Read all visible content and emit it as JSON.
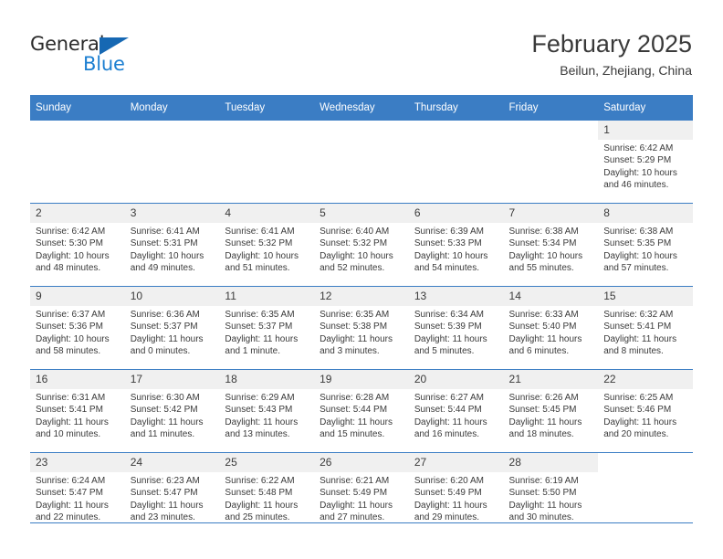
{
  "brand": {
    "name_top": "General",
    "name_bottom": "Blue",
    "triangle_icon": "blue-triangle-logo-mark",
    "color_top": "#2b2b2b",
    "color_bottom": "#1c7fd1",
    "color_triangle": "#1668b3"
  },
  "header": {
    "title": "February 2025",
    "subtitle": "Beilun, Zhejiang, China"
  },
  "theme": {
    "header_blue": "#3b7dc4",
    "daynum_band": "#f0f0f0",
    "text": "#3a3a3a"
  },
  "weekday_headers": [
    "Sunday",
    "Monday",
    "Tuesday",
    "Wednesday",
    "Thursday",
    "Friday",
    "Saturday"
  ],
  "weeks": [
    [
      {
        "day": "",
        "sunrise": "",
        "sunset": "",
        "daylight_line1": "",
        "daylight_line2": ""
      },
      {
        "day": "",
        "sunrise": "",
        "sunset": "",
        "daylight_line1": "",
        "daylight_line2": ""
      },
      {
        "day": "",
        "sunrise": "",
        "sunset": "",
        "daylight_line1": "",
        "daylight_line2": ""
      },
      {
        "day": "",
        "sunrise": "",
        "sunset": "",
        "daylight_line1": "",
        "daylight_line2": ""
      },
      {
        "day": "",
        "sunrise": "",
        "sunset": "",
        "daylight_line1": "",
        "daylight_line2": ""
      },
      {
        "day": "",
        "sunrise": "",
        "sunset": "",
        "daylight_line1": "",
        "daylight_line2": ""
      },
      {
        "day": "1",
        "sunrise": "Sunrise: 6:42 AM",
        "sunset": "Sunset: 5:29 PM",
        "daylight_line1": "Daylight: 10 hours",
        "daylight_line2": "and 46 minutes."
      }
    ],
    [
      {
        "day": "2",
        "sunrise": "Sunrise: 6:42 AM",
        "sunset": "Sunset: 5:30 PM",
        "daylight_line1": "Daylight: 10 hours",
        "daylight_line2": "and 48 minutes."
      },
      {
        "day": "3",
        "sunrise": "Sunrise: 6:41 AM",
        "sunset": "Sunset: 5:31 PM",
        "daylight_line1": "Daylight: 10 hours",
        "daylight_line2": "and 49 minutes."
      },
      {
        "day": "4",
        "sunrise": "Sunrise: 6:41 AM",
        "sunset": "Sunset: 5:32 PM",
        "daylight_line1": "Daylight: 10 hours",
        "daylight_line2": "and 51 minutes."
      },
      {
        "day": "5",
        "sunrise": "Sunrise: 6:40 AM",
        "sunset": "Sunset: 5:32 PM",
        "daylight_line1": "Daylight: 10 hours",
        "daylight_line2": "and 52 minutes."
      },
      {
        "day": "6",
        "sunrise": "Sunrise: 6:39 AM",
        "sunset": "Sunset: 5:33 PM",
        "daylight_line1": "Daylight: 10 hours",
        "daylight_line2": "and 54 minutes."
      },
      {
        "day": "7",
        "sunrise": "Sunrise: 6:38 AM",
        "sunset": "Sunset: 5:34 PM",
        "daylight_line1": "Daylight: 10 hours",
        "daylight_line2": "and 55 minutes."
      },
      {
        "day": "8",
        "sunrise": "Sunrise: 6:38 AM",
        "sunset": "Sunset: 5:35 PM",
        "daylight_line1": "Daylight: 10 hours",
        "daylight_line2": "and 57 minutes."
      }
    ],
    [
      {
        "day": "9",
        "sunrise": "Sunrise: 6:37 AM",
        "sunset": "Sunset: 5:36 PM",
        "daylight_line1": "Daylight: 10 hours",
        "daylight_line2": "and 58 minutes."
      },
      {
        "day": "10",
        "sunrise": "Sunrise: 6:36 AM",
        "sunset": "Sunset: 5:37 PM",
        "daylight_line1": "Daylight: 11 hours",
        "daylight_line2": "and 0 minutes."
      },
      {
        "day": "11",
        "sunrise": "Sunrise: 6:35 AM",
        "sunset": "Sunset: 5:37 PM",
        "daylight_line1": "Daylight: 11 hours",
        "daylight_line2": "and 1 minute."
      },
      {
        "day": "12",
        "sunrise": "Sunrise: 6:35 AM",
        "sunset": "Sunset: 5:38 PM",
        "daylight_line1": "Daylight: 11 hours",
        "daylight_line2": "and 3 minutes."
      },
      {
        "day": "13",
        "sunrise": "Sunrise: 6:34 AM",
        "sunset": "Sunset: 5:39 PM",
        "daylight_line1": "Daylight: 11 hours",
        "daylight_line2": "and 5 minutes."
      },
      {
        "day": "14",
        "sunrise": "Sunrise: 6:33 AM",
        "sunset": "Sunset: 5:40 PM",
        "daylight_line1": "Daylight: 11 hours",
        "daylight_line2": "and 6 minutes."
      },
      {
        "day": "15",
        "sunrise": "Sunrise: 6:32 AM",
        "sunset": "Sunset: 5:41 PM",
        "daylight_line1": "Daylight: 11 hours",
        "daylight_line2": "and 8 minutes."
      }
    ],
    [
      {
        "day": "16",
        "sunrise": "Sunrise: 6:31 AM",
        "sunset": "Sunset: 5:41 PM",
        "daylight_line1": "Daylight: 11 hours",
        "daylight_line2": "and 10 minutes."
      },
      {
        "day": "17",
        "sunrise": "Sunrise: 6:30 AM",
        "sunset": "Sunset: 5:42 PM",
        "daylight_line1": "Daylight: 11 hours",
        "daylight_line2": "and 11 minutes."
      },
      {
        "day": "18",
        "sunrise": "Sunrise: 6:29 AM",
        "sunset": "Sunset: 5:43 PM",
        "daylight_line1": "Daylight: 11 hours",
        "daylight_line2": "and 13 minutes."
      },
      {
        "day": "19",
        "sunrise": "Sunrise: 6:28 AM",
        "sunset": "Sunset: 5:44 PM",
        "daylight_line1": "Daylight: 11 hours",
        "daylight_line2": "and 15 minutes."
      },
      {
        "day": "20",
        "sunrise": "Sunrise: 6:27 AM",
        "sunset": "Sunset: 5:44 PM",
        "daylight_line1": "Daylight: 11 hours",
        "daylight_line2": "and 16 minutes."
      },
      {
        "day": "21",
        "sunrise": "Sunrise: 6:26 AM",
        "sunset": "Sunset: 5:45 PM",
        "daylight_line1": "Daylight: 11 hours",
        "daylight_line2": "and 18 minutes."
      },
      {
        "day": "22",
        "sunrise": "Sunrise: 6:25 AM",
        "sunset": "Sunset: 5:46 PM",
        "daylight_line1": "Daylight: 11 hours",
        "daylight_line2": "and 20 minutes."
      }
    ],
    [
      {
        "day": "23",
        "sunrise": "Sunrise: 6:24 AM",
        "sunset": "Sunset: 5:47 PM",
        "daylight_line1": "Daylight: 11 hours",
        "daylight_line2": "and 22 minutes."
      },
      {
        "day": "24",
        "sunrise": "Sunrise: 6:23 AM",
        "sunset": "Sunset: 5:47 PM",
        "daylight_line1": "Daylight: 11 hours",
        "daylight_line2": "and 23 minutes."
      },
      {
        "day": "25",
        "sunrise": "Sunrise: 6:22 AM",
        "sunset": "Sunset: 5:48 PM",
        "daylight_line1": "Daylight: 11 hours",
        "daylight_line2": "and 25 minutes."
      },
      {
        "day": "26",
        "sunrise": "Sunrise: 6:21 AM",
        "sunset": "Sunset: 5:49 PM",
        "daylight_line1": "Daylight: 11 hours",
        "daylight_line2": "and 27 minutes."
      },
      {
        "day": "27",
        "sunrise": "Sunrise: 6:20 AM",
        "sunset": "Sunset: 5:49 PM",
        "daylight_line1": "Daylight: 11 hours",
        "daylight_line2": "and 29 minutes."
      },
      {
        "day": "28",
        "sunrise": "Sunrise: 6:19 AM",
        "sunset": "Sunset: 5:50 PM",
        "daylight_line1": "Daylight: 11 hours",
        "daylight_line2": "and 30 minutes."
      },
      {
        "day": "",
        "sunrise": "",
        "sunset": "",
        "daylight_line1": "",
        "daylight_line2": ""
      }
    ]
  ]
}
